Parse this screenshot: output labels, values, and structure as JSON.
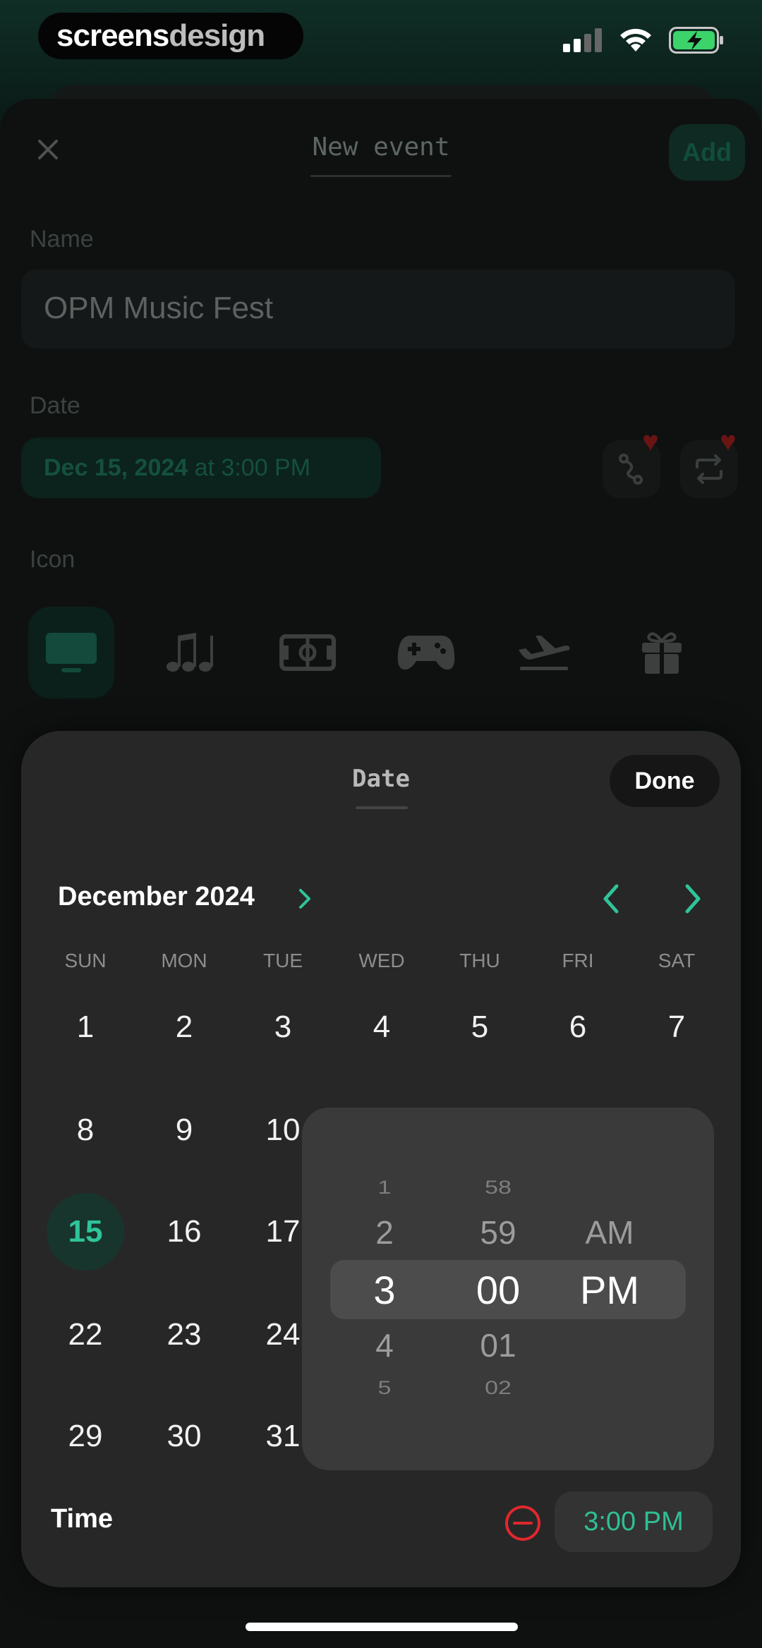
{
  "branding": {
    "logo_part1": "screens",
    "logo_part2": "design"
  },
  "header": {
    "title": "New event",
    "add_label": "Add"
  },
  "name_field": {
    "label": "Name",
    "value": "OPM Music Fest"
  },
  "date_field": {
    "label": "Date",
    "date_value": "Dec 15, 2024",
    "at_text": "at 3:00 PM"
  },
  "icon_section": {
    "label": "Icon",
    "icons": [
      "tv-icon",
      "music-notes-icon",
      "stadium-icon",
      "gamepad-icon",
      "airplane-icon",
      "gift-icon"
    ],
    "selected": "tv-icon"
  },
  "picker": {
    "title": "Date",
    "done_label": "Done",
    "month_label": "December 2024",
    "weekdays": [
      "SUN",
      "MON",
      "TUE",
      "WED",
      "THU",
      "FRI",
      "SAT"
    ],
    "days": [
      [
        "1",
        "2",
        "3",
        "4",
        "5",
        "6",
        "7"
      ],
      [
        "8",
        "9",
        "10",
        "",
        "",
        "",
        ""
      ],
      [
        "15",
        "16",
        "17",
        "",
        "",
        "",
        ""
      ],
      [
        "22",
        "23",
        "24",
        "",
        "",
        "",
        ""
      ],
      [
        "29",
        "30",
        "31",
        "",
        "",
        "",
        ""
      ]
    ],
    "selected_day": "15",
    "time_label": "Time",
    "time_value": "3:00 PM"
  },
  "time_wheel": {
    "hours": [
      "1",
      "2",
      "3",
      "4",
      "5"
    ],
    "minutes": [
      "58",
      "59",
      "00",
      "01",
      "02"
    ],
    "periods": [
      "AM",
      "PM"
    ],
    "selected": {
      "hour": "3",
      "minute": "00",
      "period": "PM"
    }
  },
  "colors": {
    "accent": "#2fc49a",
    "remove": "#e0282e",
    "heart": "#6a1414"
  }
}
